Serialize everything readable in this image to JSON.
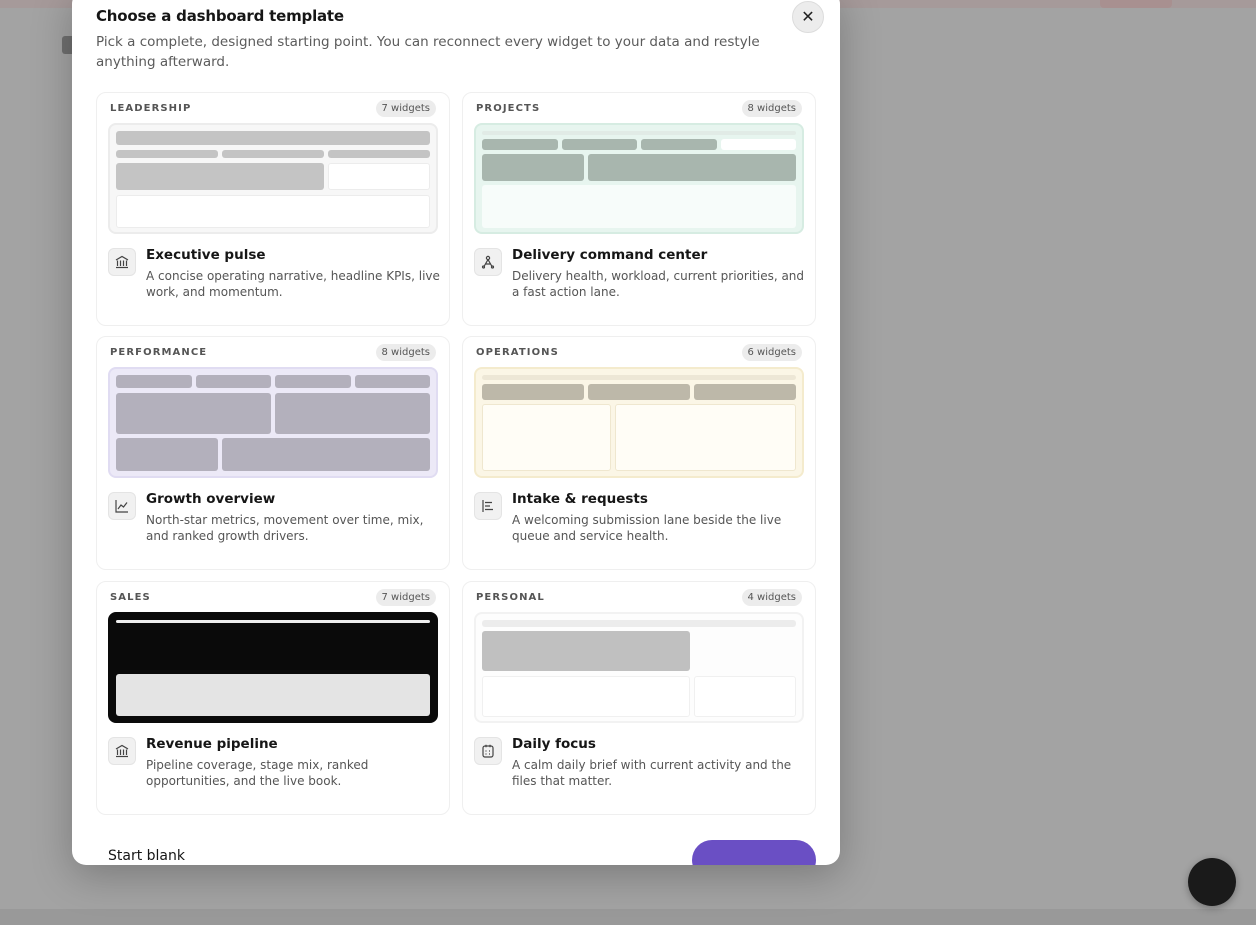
{
  "modal": {
    "title": "Choose a dashboard template",
    "subtitle": "Pick a complete, designed starting point. You can reconnect every widget to your data and restyle anything afterward.",
    "close_label": "✕"
  },
  "templates": [
    {
      "category": "LEADERSHIP",
      "widgets": "7 widgets",
      "title": "Executive pulse",
      "description": "A concise operating narrative, headline KPIs, live work, and momentum.",
      "icon": "bank-icon"
    },
    {
      "category": "PROJECTS",
      "widgets": "8 widgets",
      "title": "Delivery command center",
      "description": "Delivery health, workload, current priorities, and a fast action lane.",
      "icon": "route-icon"
    },
    {
      "category": "PERFORMANCE",
      "widgets": "8 widgets",
      "title": "Growth overview",
      "description": "North-star metrics, movement over time, mix, and ranked growth drivers.",
      "icon": "line-chart-icon"
    },
    {
      "category": "OPERATIONS",
      "widgets": "6 widgets",
      "title": "Intake & requests",
      "description": "A welcoming submission lane beside the live queue and service health.",
      "icon": "align-left-icon"
    },
    {
      "category": "SALES",
      "widgets": "7 widgets",
      "title": "Revenue pipeline",
      "description": "Pipeline coverage, stage mix, ranked opportunities, and the live book.",
      "icon": "bank-icon"
    },
    {
      "category": "PERSONAL",
      "widgets": "4 widgets",
      "title": "Daily focus",
      "description": "A calm daily brief with current activity and the files that matter.",
      "icon": "calendar-icon"
    }
  ],
  "footer": {
    "start_blank": "Start blank",
    "primary_label": ""
  },
  "colors": {
    "accent": "#6a4fc4",
    "projects_tint": "#e7f5ef",
    "performance_tint": "#ece9f7",
    "operations_tint": "#fbf6e6",
    "sales_dark": "#0a0a0a"
  }
}
